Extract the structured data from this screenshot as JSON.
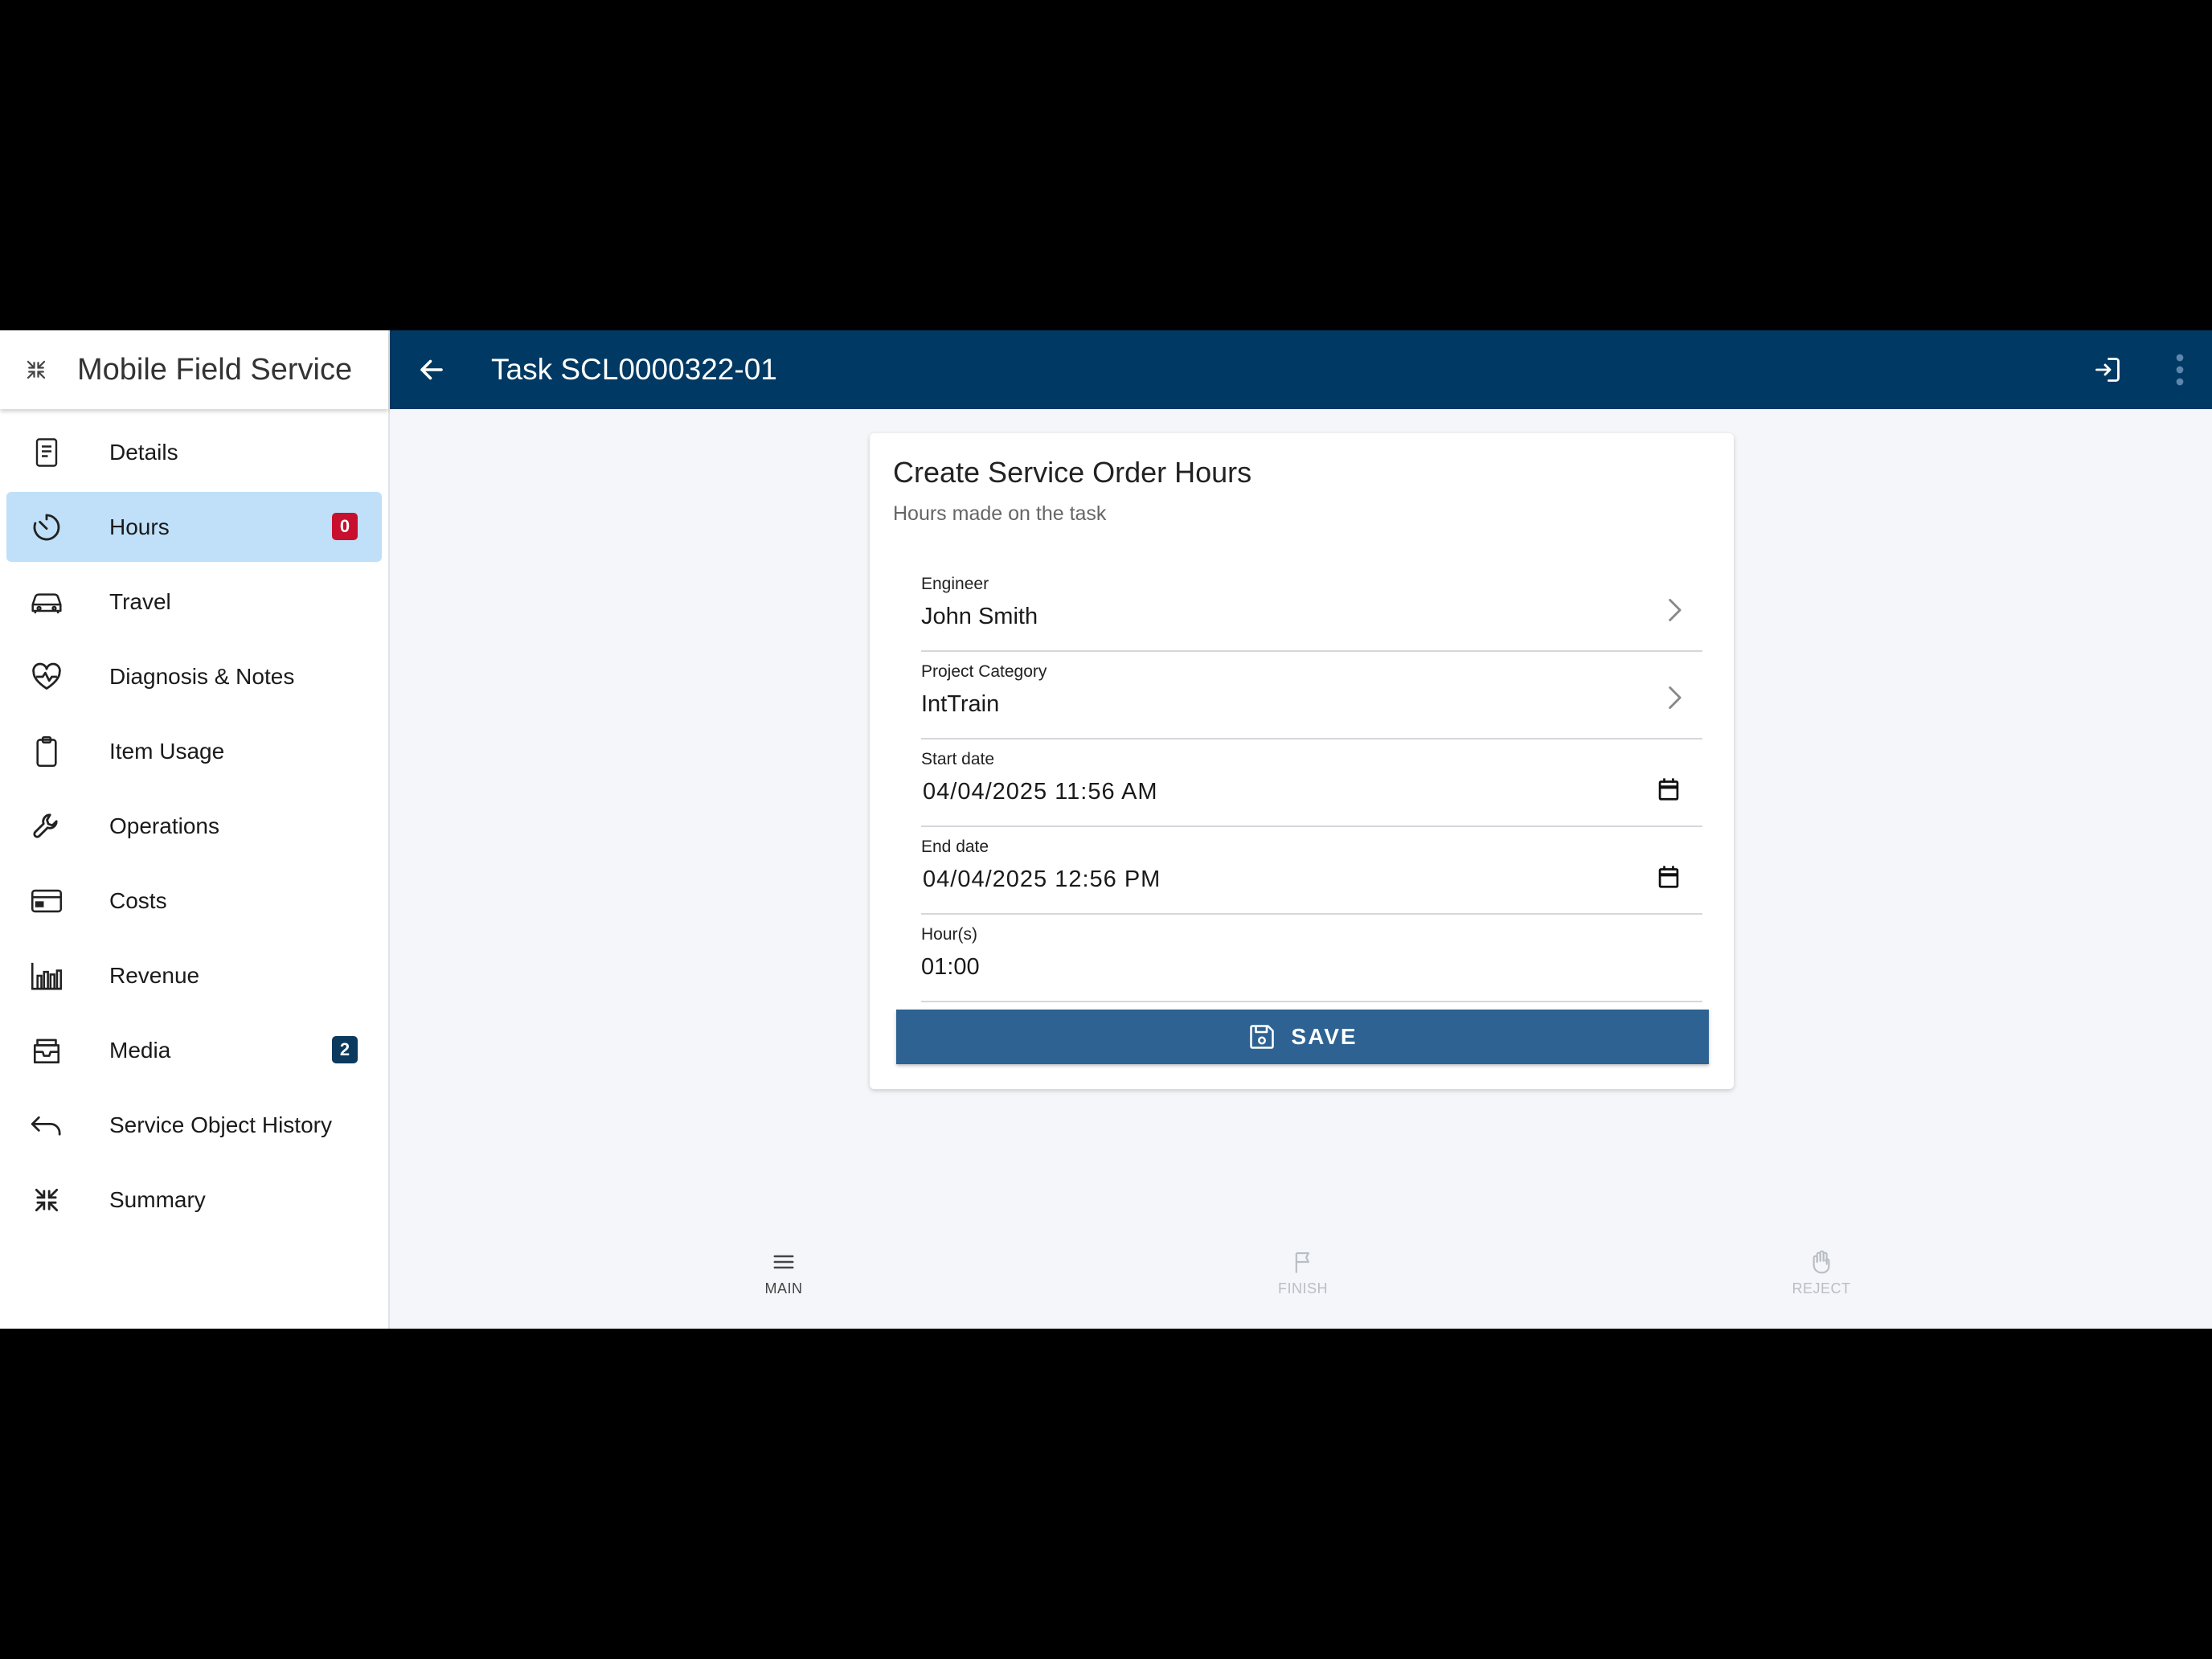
{
  "app": {
    "title": "Mobile Field Service"
  },
  "header": {
    "task_title": "Task SCL0000322-01"
  },
  "sidebar": {
    "items": [
      {
        "label": "Details",
        "icon": "document-icon"
      },
      {
        "label": "Hours",
        "icon": "timer-icon",
        "badge": "0",
        "active": true
      },
      {
        "label": "Travel",
        "icon": "car-icon"
      },
      {
        "label": "Diagnosis & Notes",
        "icon": "heart-pulse-icon"
      },
      {
        "label": "Item Usage",
        "icon": "clipboard-icon"
      },
      {
        "label": "Operations",
        "icon": "wrench-icon"
      },
      {
        "label": "Costs",
        "icon": "credit-card-icon"
      },
      {
        "label": "Revenue",
        "icon": "bar-chart-icon"
      },
      {
        "label": "Media",
        "icon": "inbox-icon",
        "badge": "2"
      },
      {
        "label": "Service Object History",
        "icon": "undo-arrow-icon"
      },
      {
        "label": "Summary",
        "icon": "collapse-icon"
      }
    ]
  },
  "form": {
    "title": "Create Service Order Hours",
    "subtitle": "Hours made on the task",
    "engineer": {
      "label": "Engineer",
      "value": "John Smith"
    },
    "project_category": {
      "label": "Project Category",
      "value": "IntTrain"
    },
    "start_date": {
      "label": "Start date",
      "value": "04/04/2025 11:56 AM"
    },
    "end_date": {
      "label": "End date",
      "value": "04/04/2025 12:56 PM"
    },
    "hours": {
      "label": "Hour(s)",
      "value": "01:00"
    },
    "save_label": "SAVE"
  },
  "bottom_nav": {
    "main": "MAIN",
    "finish": "FINISH",
    "reject": "REJECT"
  },
  "colors": {
    "primary": "#003963",
    "save_button": "#2d6293",
    "active_nav": "#bfe0f8",
    "badge_red": "#c8102e",
    "badge_navy": "#0b3a5e"
  }
}
